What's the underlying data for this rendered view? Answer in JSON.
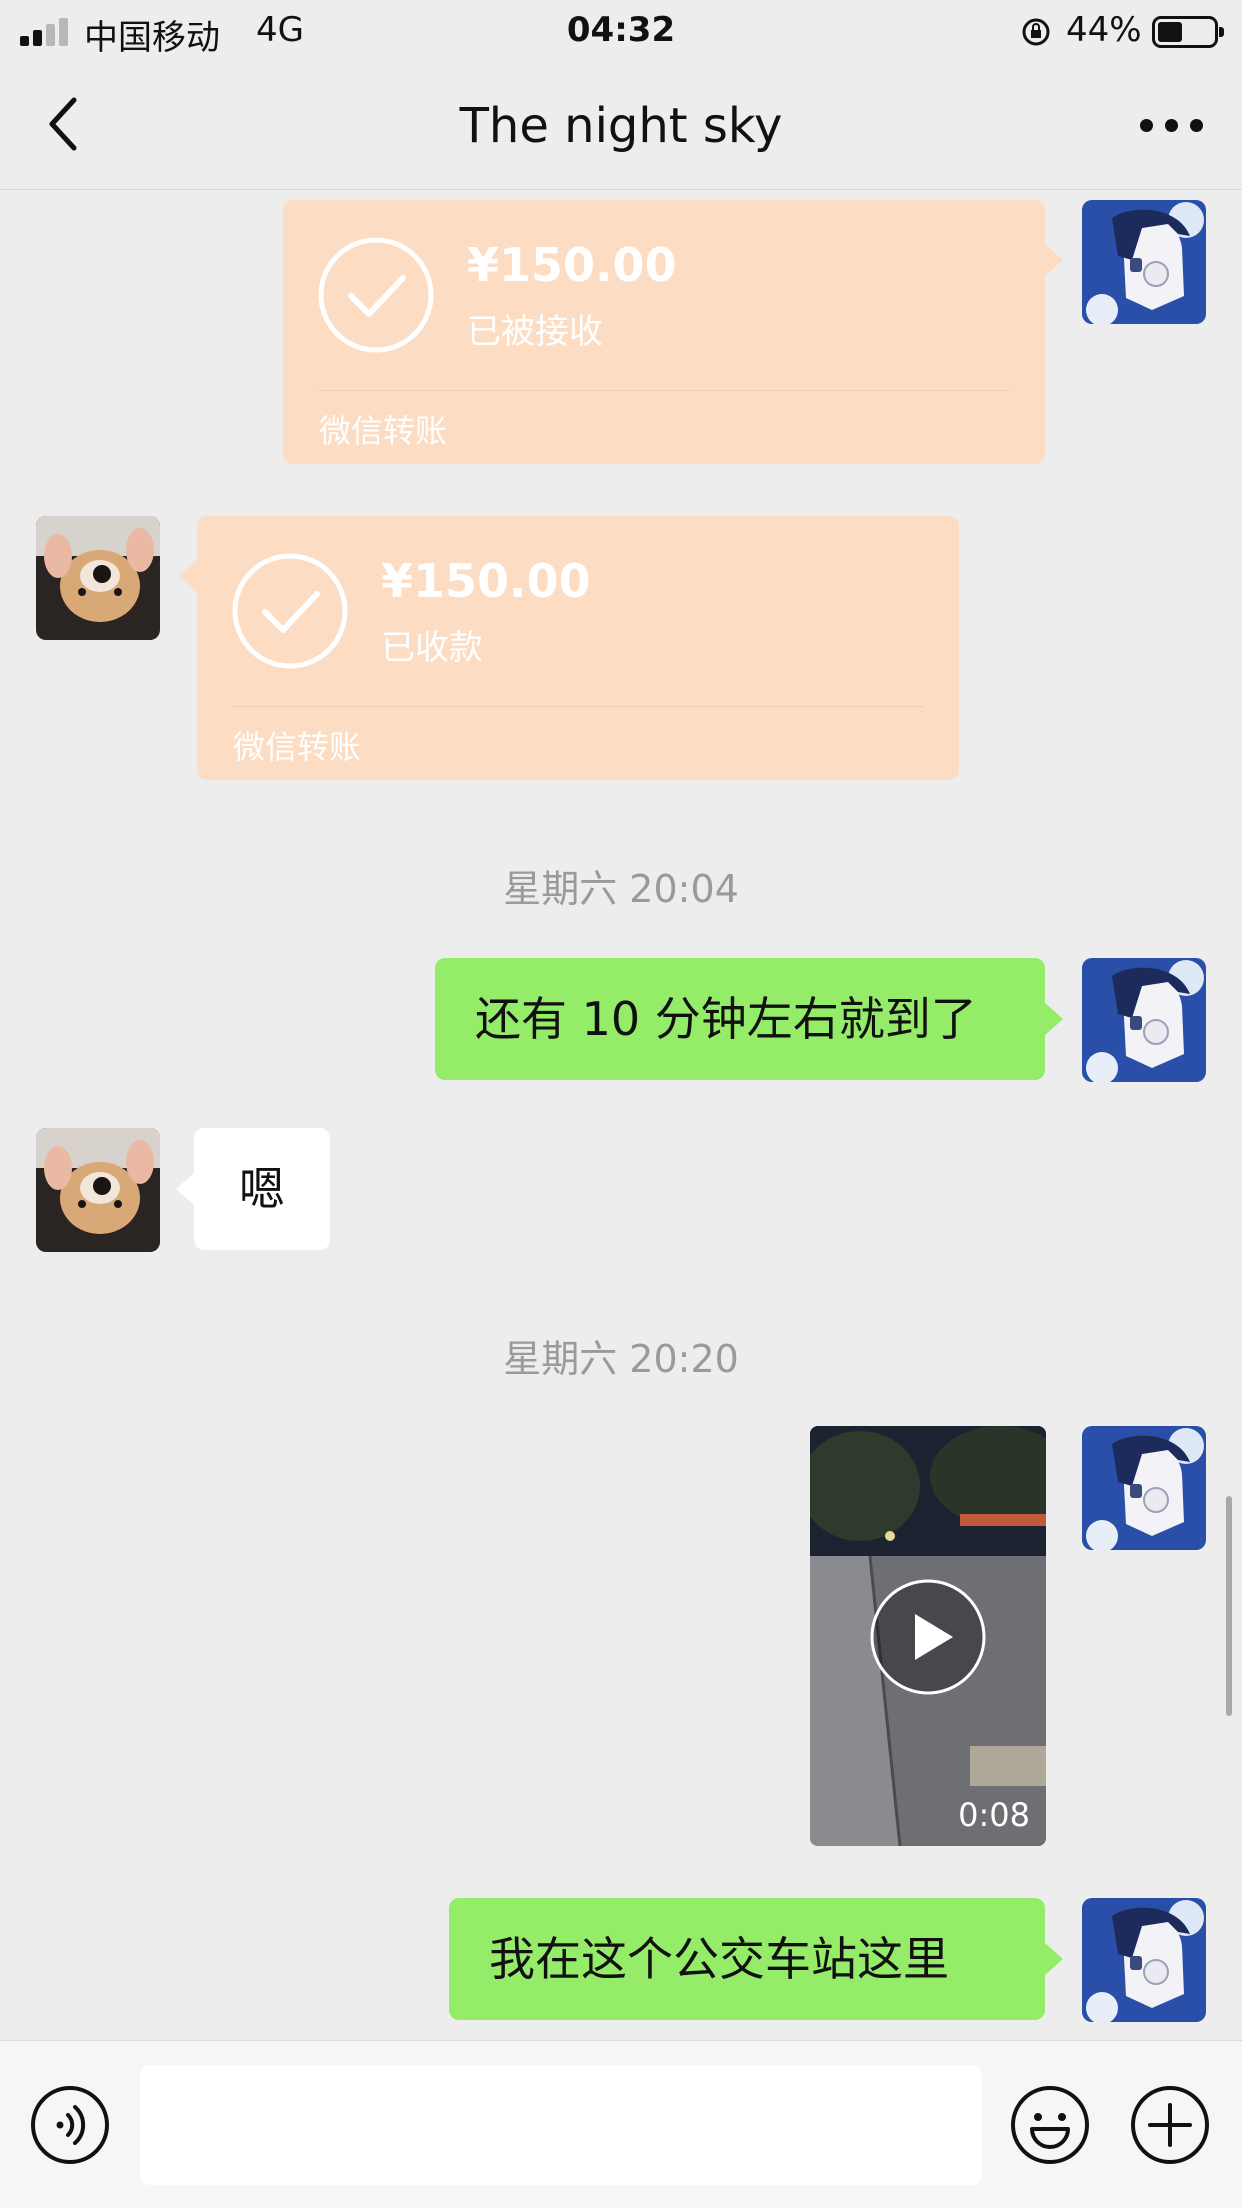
{
  "status_bar": {
    "carrier": "中国移动",
    "network": "4G",
    "time": "04:32",
    "battery_percent": "44%"
  },
  "nav": {
    "title": "The night sky",
    "back_icon": "chevron-left-icon",
    "more_icon": "more-horizontal-icon"
  },
  "messages": {
    "transfer_1": {
      "amount": "¥150.00",
      "status": "已被接收",
      "footer": "微信转账"
    },
    "transfer_2": {
      "amount": "¥150.00",
      "status": "已收款",
      "footer": "微信转账"
    },
    "timestamp_1": "星期六 20:04",
    "text_1": "还有 10 分钟左右就到了",
    "text_2": "嗯",
    "timestamp_2": "星期六 20:20",
    "video_1": {
      "duration": "0:08"
    },
    "text_3": "我在这个公交车站这里"
  },
  "input_bar": {
    "voice_icon": "voice-icon",
    "emoji_icon": "emoji-icon",
    "plus_icon": "plus-icon",
    "input_value": ""
  },
  "colors": {
    "background": "#ededed",
    "green_bubble": "#95ec69",
    "transfer_card": "#fcdcc2",
    "timestamp": "#9a9a9a"
  }
}
